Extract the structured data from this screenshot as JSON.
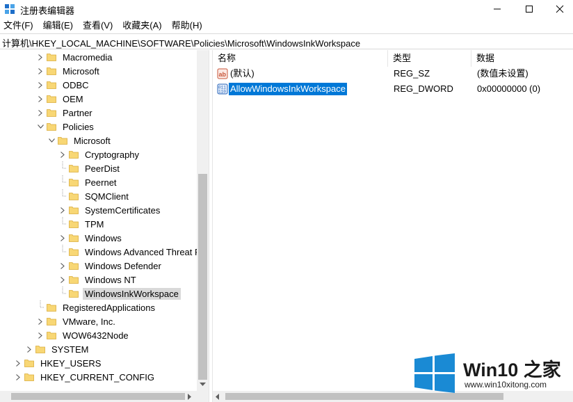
{
  "window": {
    "title": "注册表编辑器",
    "icon": "regedit-icon"
  },
  "menu": [
    "文件(F)",
    "编辑(E)",
    "查看(V)",
    "收藏夹(A)",
    "帮助(H)"
  ],
  "address": "计算机\\HKEY_LOCAL_MACHINE\\SOFTWARE\\Policies\\Microsoft\\WindowsInkWorkspace",
  "tree": {
    "items": [
      {
        "label": "Macromedia",
        "expander": "collapsed"
      },
      {
        "label": "Microsoft",
        "expander": "collapsed"
      },
      {
        "label": "ODBC",
        "expander": "collapsed"
      },
      {
        "label": "OEM",
        "expander": "collapsed"
      },
      {
        "label": "Partner",
        "expander": "collapsed"
      },
      {
        "label": "Policies",
        "expander": "expanded"
      },
      {
        "label": "Microsoft",
        "expander": "expanded"
      },
      {
        "label": "Cryptography",
        "expander": "collapsed"
      },
      {
        "label": "PeerDist",
        "expander": "none"
      },
      {
        "label": "Peernet",
        "expander": "none"
      },
      {
        "label": "SQMClient",
        "expander": "none"
      },
      {
        "label": "SystemCertificates",
        "expander": "collapsed"
      },
      {
        "label": "TPM",
        "expander": "none"
      },
      {
        "label": "Windows",
        "expander": "collapsed"
      },
      {
        "label": "Windows Advanced Threat P",
        "expander": "none"
      },
      {
        "label": "Windows Defender",
        "expander": "collapsed"
      },
      {
        "label": "Windows NT",
        "expander": "collapsed"
      },
      {
        "label": "WindowsInkWorkspace",
        "expander": "none",
        "selected": true
      },
      {
        "label": "RegisteredApplications",
        "expander": "none"
      },
      {
        "label": "VMware, Inc.",
        "expander": "collapsed"
      },
      {
        "label": "WOW6432Node",
        "expander": "collapsed"
      },
      {
        "label": "SYSTEM",
        "expander": "collapsed"
      },
      {
        "label": "HKEY_USERS",
        "expander": "collapsed"
      },
      {
        "label": "HKEY_CURRENT_CONFIG",
        "expander": "collapsed"
      }
    ]
  },
  "values": {
    "columns": {
      "name": "名称",
      "type": "类型",
      "data": "数据"
    },
    "rows": [
      {
        "name": "(默认)",
        "type": "REG_SZ",
        "data": "(数值未设置)",
        "icon": "string-value-icon"
      },
      {
        "name": "AllowWindowsInkWorkspace",
        "type": "REG_DWORD",
        "data": "0x00000000 (0)",
        "icon": "dword-value-icon",
        "selected": true
      }
    ]
  },
  "watermark": {
    "brand": "Win10 之家",
    "url": "www.win10xitong.com"
  },
  "colors": {
    "selection_blue": "#0078d7",
    "folder_yellow": "#f8d775",
    "win_logo_blue": "#1a8ad4"
  }
}
